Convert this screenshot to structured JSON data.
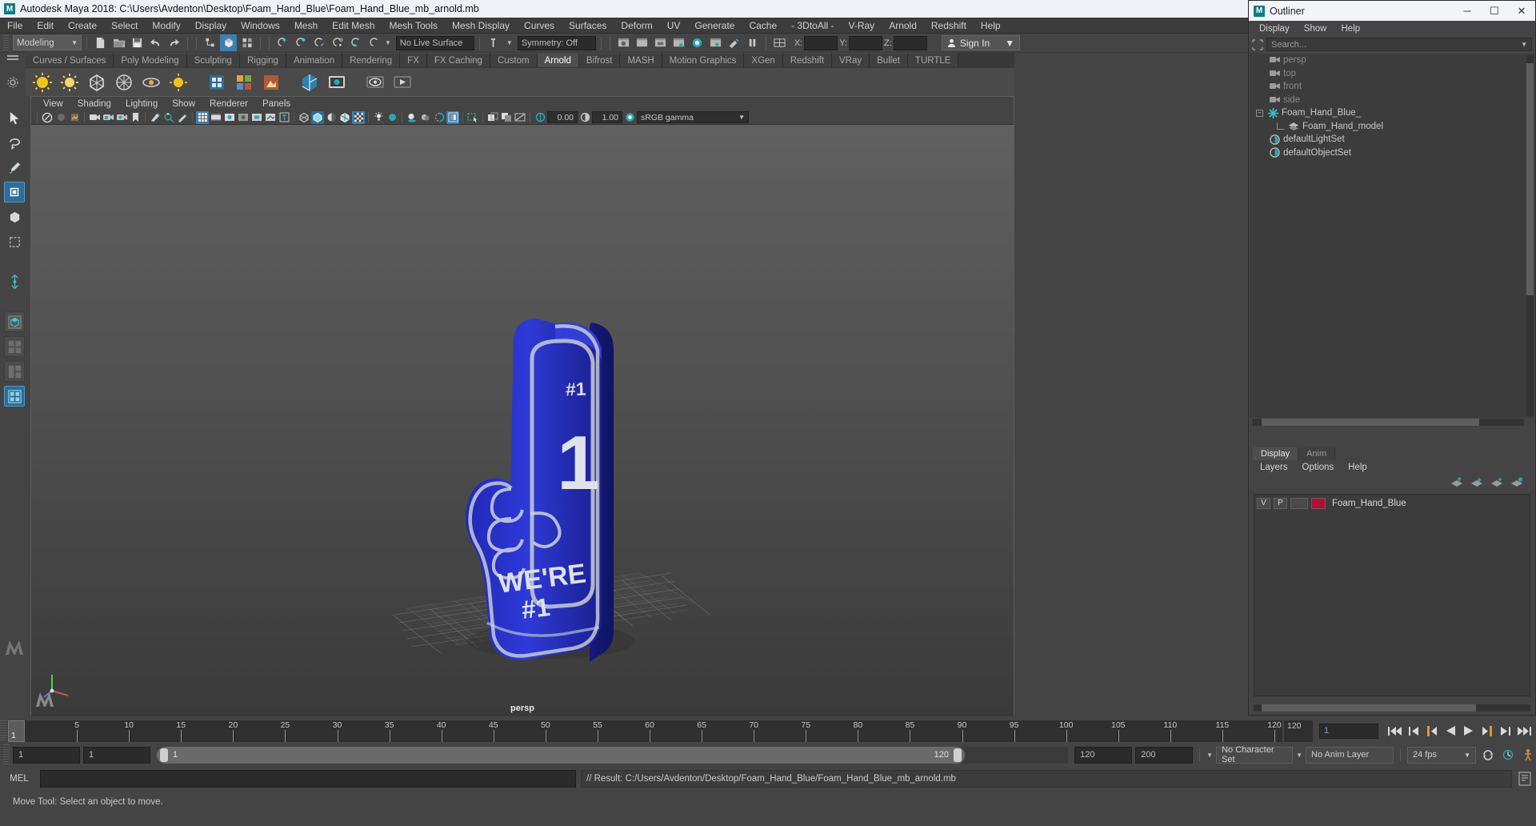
{
  "window": {
    "title": "Autodesk Maya 2018: C:\\Users\\Avdenton\\Desktop\\Foam_Hand_Blue\\Foam_Hand_Blue_mb_arnold.mb",
    "logo": "maya-logo",
    "accent": "#3c7fb1",
    "teal": "#23a6b0"
  },
  "menubar": {
    "items": [
      {
        "label": "File"
      },
      {
        "label": "Edit"
      },
      {
        "label": "Create"
      },
      {
        "label": "Select"
      },
      {
        "label": "Modify"
      },
      {
        "label": "Display"
      },
      {
        "label": "Windows"
      },
      {
        "label": "Mesh"
      },
      {
        "label": "Edit Mesh"
      },
      {
        "label": "Mesh Tools"
      },
      {
        "label": "Mesh Display"
      },
      {
        "label": "Curves"
      },
      {
        "label": "Surfaces"
      },
      {
        "label": "Deform"
      },
      {
        "label": "UV"
      },
      {
        "label": "Generate"
      },
      {
        "label": "Cache"
      },
      {
        "label": "- 3DtoAll -"
      },
      {
        "label": "V-Ray"
      },
      {
        "label": "Arnold"
      },
      {
        "label": "Redshift"
      },
      {
        "label": "Help"
      }
    ]
  },
  "statusbar": {
    "menu_set": "Modeling",
    "live_surface": "No Live Surface",
    "symmetry": "Symmetry: Off",
    "x_label": "X:",
    "y_label": "Y:",
    "z_label": "Z:",
    "x_value": "",
    "y_value": "",
    "z_value": "",
    "signin_label": "Sign In",
    "signin_icon": "user-icon"
  },
  "shelf": {
    "tabs": [
      {
        "label": "Curves / Surfaces",
        "active": false
      },
      {
        "label": "Poly Modeling",
        "active": false
      },
      {
        "label": "Sculpting",
        "active": false
      },
      {
        "label": "Rigging",
        "active": false
      },
      {
        "label": "Animation",
        "active": false
      },
      {
        "label": "Rendering",
        "active": false
      },
      {
        "label": "FX",
        "active": false
      },
      {
        "label": "FX Caching",
        "active": false
      },
      {
        "label": "Custom",
        "active": false
      },
      {
        "label": "Arnold",
        "active": true
      },
      {
        "label": "Bifrost",
        "active": false
      },
      {
        "label": "MASH",
        "active": false
      },
      {
        "label": "Motion Graphics",
        "active": false
      },
      {
        "label": "XGen",
        "active": false
      },
      {
        "label": "Redshift",
        "active": false
      },
      {
        "label": "VRay",
        "active": false
      },
      {
        "label": "Bullet",
        "active": false
      },
      {
        "label": "TURTLE",
        "active": false
      }
    ],
    "icons": [
      "arnold-area-light-icon",
      "arnold-skydome-light-icon",
      "arnold-mesh-light-icon",
      "arnold-photometric-light-icon",
      "arnold-light-portal-icon",
      "arnold-physical-sky-icon",
      "arnold-standin-icon",
      "arnold-volume-icon",
      "arnold-procedural-icon",
      "arnold-scene-source-icon",
      "arnold-render-icon",
      "arnold-flush-caches-icon",
      "arnold-license-icon",
      "arnold-open-render-view-icon",
      "arnold-batch-render-icon"
    ]
  },
  "toolbox": {
    "tools": [
      {
        "name": "select-tool-icon",
        "selected": false
      },
      {
        "name": "lasso-select-tool-icon",
        "selected": false
      },
      {
        "name": "paint-select-tool-icon",
        "selected": false
      },
      {
        "name": "move-tool-icon",
        "selected": true
      },
      {
        "name": "rotate-tool-icon",
        "selected": false
      },
      {
        "name": "scale-tool-icon",
        "selected": false
      },
      {
        "name": "last-tool-icon",
        "selected": false
      },
      {
        "name": "single-perspective-view-icon",
        "selected": false
      },
      {
        "name": "four-view-layout-icon",
        "selected": false
      },
      {
        "name": "persp-outliner-layout-icon",
        "selected": false
      },
      {
        "name": "hypershade-layout-icon",
        "selected": true
      }
    ]
  },
  "viewport": {
    "menus": [
      "View",
      "Shading",
      "Lighting",
      "Show",
      "Renderer",
      "Panels"
    ],
    "camera_label": "persp",
    "exposure_value": "0.00",
    "gamma_value": "1.00",
    "color_space": "sRGB gamma",
    "color_space_icon": "color-management-icon",
    "icons": [
      "select-camera-icon",
      "lock-camera-icon",
      "camera-attributes-icon",
      "bookmark-icon",
      "image-plane-icon",
      "2d-pan-zoom-icon",
      "grease-pencil-icon",
      "grid-toggle-icon",
      "film-gate-icon",
      "resolution-gate-icon",
      "gate-mask-icon",
      "film-origin-icon",
      "xray-icon",
      "text-overlay-icon",
      "wireframe-shading-icon",
      "smooth-shading-icon",
      "flat-shading-icon",
      "shaded-wireframe-icon",
      "textured-icon",
      "use-default-lighting-icon",
      "use-all-lights-icon",
      "shadows-icon",
      "ambient-occlusion-icon",
      "motion-blur-icon",
      "multisample-icon",
      "isolate-select-icon",
      "xray-joints-icon",
      "xray-active-icon",
      "exposure-icon",
      "gamma-icon"
    ],
    "model": {
      "name": "Foam_Hand_Blue",
      "color": "#2b35c9",
      "text_top": "#1",
      "text_mid": "1",
      "text_bottom_line1": "WE'RE",
      "text_bottom_line2": "#1"
    }
  },
  "outliner": {
    "title": "Outliner",
    "window_buttons": [
      {
        "name": "minimize-button",
        "glyph": "─"
      },
      {
        "name": "maximize-button",
        "glyph": "☐"
      },
      {
        "name": "close-button",
        "glyph": "✕"
      }
    ],
    "menus": [
      "Display",
      "Show",
      "Help"
    ],
    "search_placeholder": "Search...",
    "filter_icon": "filter-icon",
    "items": [
      {
        "label": "persp",
        "icon": "camera-icon",
        "dim": true,
        "indent": 1
      },
      {
        "label": "top",
        "icon": "camera-icon",
        "dim": true,
        "indent": 1
      },
      {
        "label": "front",
        "icon": "camera-icon",
        "dim": true,
        "indent": 1
      },
      {
        "label": "side",
        "icon": "camera-icon",
        "dim": true,
        "indent": 1
      },
      {
        "label": "Foam_Hand_Blue_",
        "icon": "transform-icon",
        "dim": false,
        "indent": 0,
        "expanded": true
      },
      {
        "label": "Foam_Hand_model",
        "icon": "mesh-icon",
        "dim": false,
        "indent": 2
      },
      {
        "label": "defaultLightSet",
        "icon": "set-icon",
        "dim": false,
        "indent": 1
      },
      {
        "label": "defaultObjectSet",
        "icon": "set-icon",
        "dim": false,
        "indent": 1
      }
    ]
  },
  "layer_editor": {
    "tabs": [
      {
        "label": "Display",
        "active": true
      },
      {
        "label": "Anim",
        "active": false
      }
    ],
    "menus": [
      "Layers",
      "Options",
      "Help"
    ],
    "buttons": [
      "move-layer-up-icon",
      "move-layer-down-icon",
      "create-new-layer-icon",
      "create-layer-from-selected-icon"
    ],
    "layers": [
      {
        "visibility": "V",
        "playback": "P",
        "shading": "",
        "color": "#b01030",
        "name": "Foam_Hand_Blue"
      }
    ]
  },
  "timeslider": {
    "current_frame": "1",
    "start_tick": "1",
    "end_label": "120",
    "ticks": [
      5,
      10,
      15,
      20,
      25,
      30,
      35,
      40,
      45,
      50,
      55,
      60,
      65,
      70,
      75,
      80,
      85,
      90,
      95,
      100,
      105,
      110,
      115,
      120
    ],
    "frame_field": "1",
    "playback_buttons": [
      "go-to-start-icon",
      "step-back-keyframe-icon",
      "step-back-frame-icon",
      "play-backwards-icon",
      "play-forwards-icon",
      "step-forward-frame-icon",
      "step-forward-keyframe-icon",
      "go-to-end-icon"
    ]
  },
  "rangebar": {
    "anim_start": "1",
    "range_start": "1",
    "slider_start_label": "1",
    "slider_end_label": "120",
    "range_end": "120",
    "anim_end": "200",
    "character_set": "No Character Set",
    "anim_layer": "No Anim Layer",
    "fps": "24 fps",
    "icons": [
      "auto-keyframe-icon",
      "animation-preferences-icon",
      "character-icon"
    ]
  },
  "commandline": {
    "label": "MEL",
    "input_value": "",
    "result": "// Result: C:/Users/Avdenton/Desktop/Foam_Hand_Blue/Foam_Hand_Blue_mb_arnold.mb",
    "script_editor_icon": "script-editor-icon"
  },
  "helpline": {
    "text": "Move Tool: Select an object to move."
  }
}
